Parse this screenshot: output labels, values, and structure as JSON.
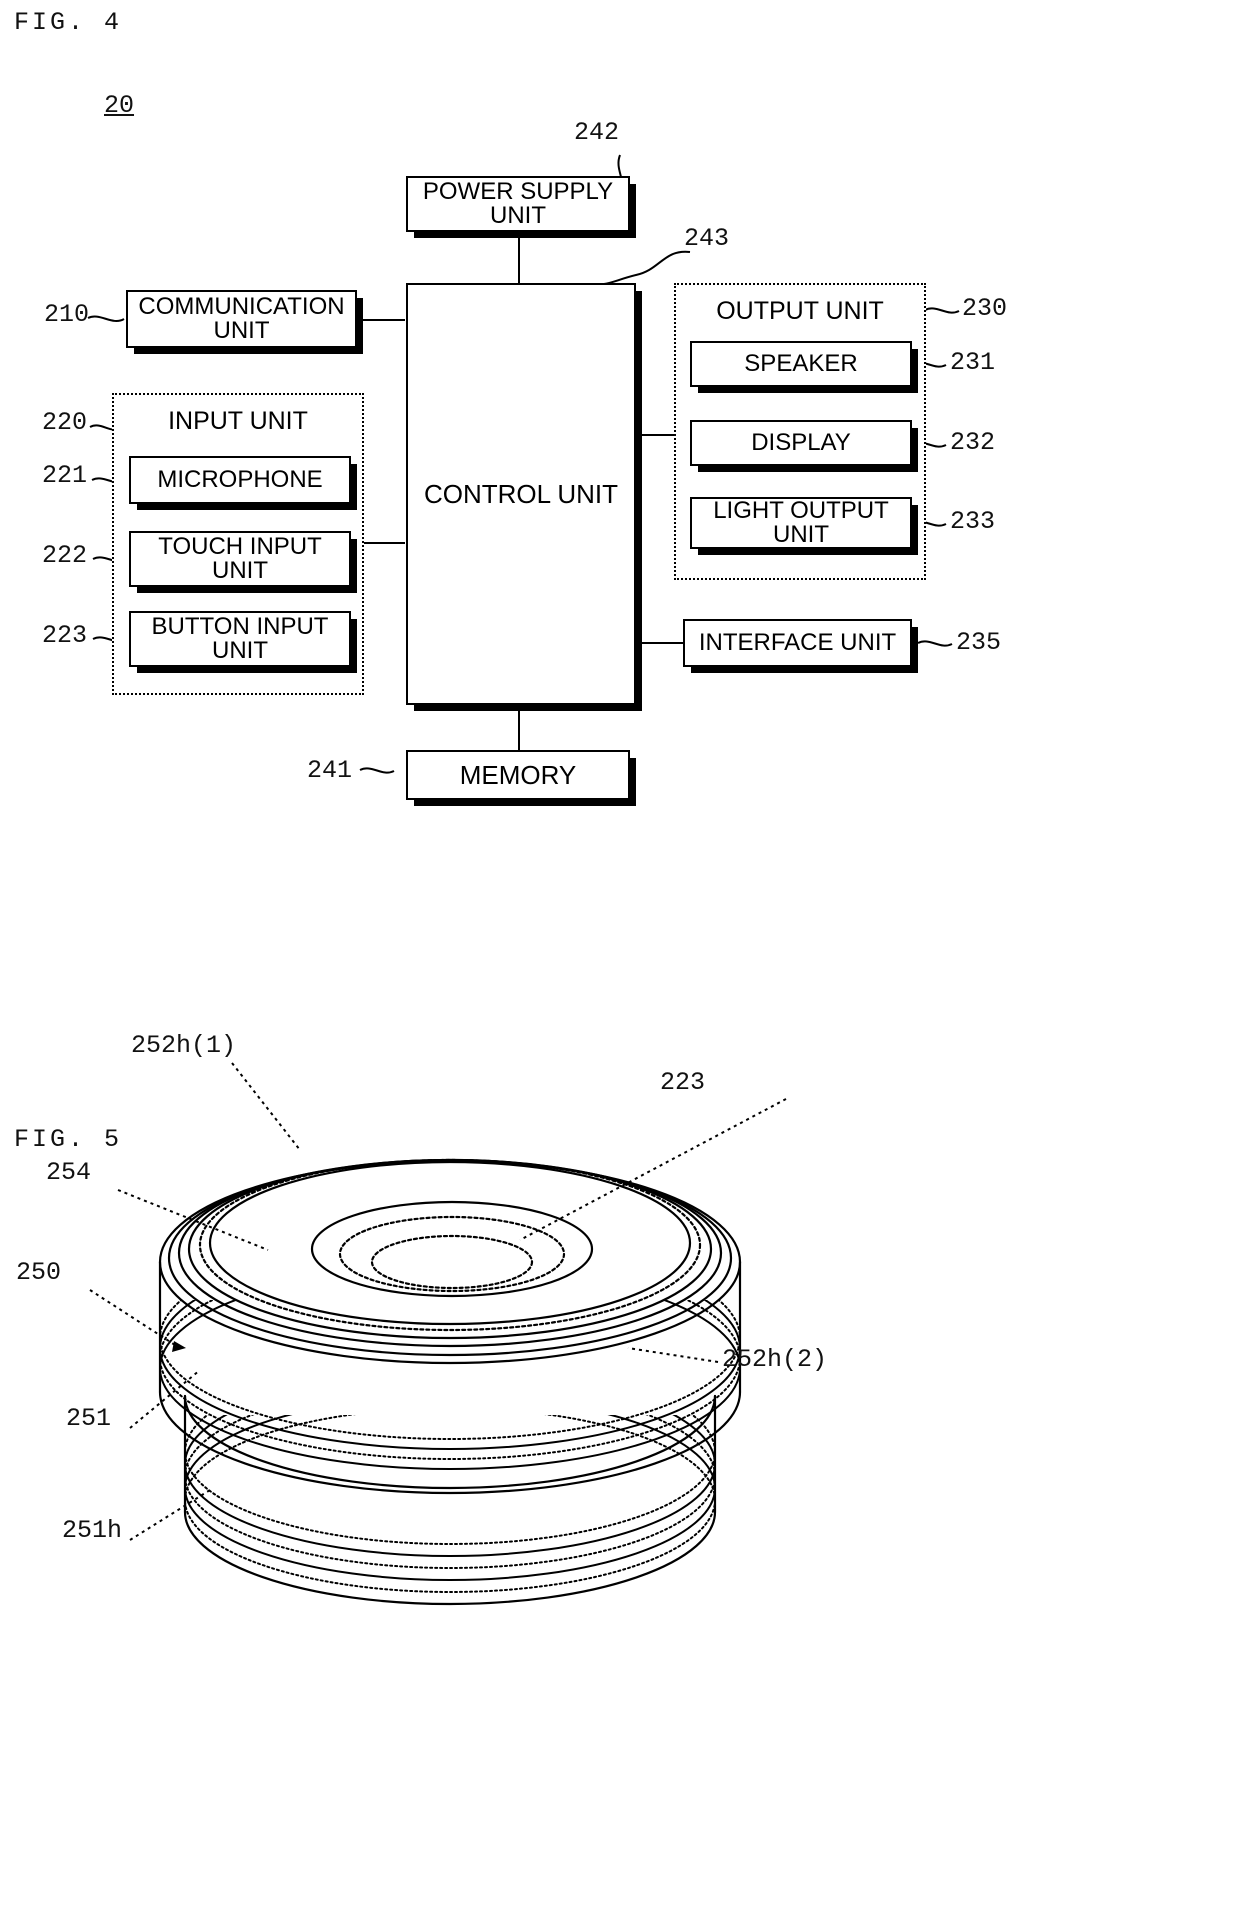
{
  "figures": [
    {
      "caption": "FIG. 4",
      "assembly_ref": "20"
    },
    {
      "caption": "FIG. 5"
    }
  ],
  "fig4": {
    "caption": "FIG. 4",
    "assembly_ref": "20",
    "boxes": {
      "power_supply": {
        "label": "POWER SUPPLY\nUNIT",
        "ref": "242"
      },
      "communication": {
        "label": "COMMUNICATION\nUNIT",
        "ref": "210"
      },
      "control": {
        "label": "CONTROL UNIT",
        "ref": "243"
      },
      "memory": {
        "label": "MEMORY",
        "ref": "241"
      },
      "interface": {
        "label": "INTERFACE UNIT",
        "ref": "235"
      }
    },
    "input_unit": {
      "title": "INPUT UNIT",
      "ref": "220",
      "items": [
        {
          "label": "MICROPHONE",
          "ref": "221"
        },
        {
          "label": "TOUCH INPUT\nUNIT",
          "ref": "222"
        },
        {
          "label": "BUTTON INPUT\nUNIT",
          "ref": "223"
        }
      ]
    },
    "output_unit": {
      "title": "OUTPUT UNIT",
      "ref": "230",
      "items": [
        {
          "label": "SPEAKER",
          "ref": "231"
        },
        {
          "label": "DISPLAY",
          "ref": "232"
        },
        {
          "label": "LIGHT OUTPUT\nUNIT",
          "ref": "233"
        }
      ]
    }
  },
  "fig5": {
    "caption": "FIG. 5",
    "labels": [
      {
        "id": "label-252h1",
        "text": "252h(1)"
      },
      {
        "id": "label-223",
        "text": "223"
      },
      {
        "id": "label-254",
        "text": "254"
      },
      {
        "id": "label-250",
        "text": "250"
      },
      {
        "id": "label-252h2",
        "text": "252h(2)"
      },
      {
        "id": "label-251",
        "text": "251"
      },
      {
        "id": "label-251h",
        "text": "251h"
      }
    ]
  },
  "colors": {
    "ink": "#000000",
    "paper": "#ffffff"
  }
}
